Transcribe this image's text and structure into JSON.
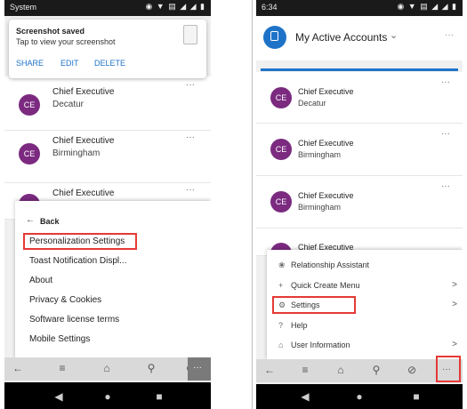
{
  "left": {
    "status": {
      "app": "System",
      "icons": "◉ ▼ ▤ ◢ ◢ ▮"
    },
    "notification": {
      "title": "Screenshot saved",
      "subtitle": "Tap to view your screenshot",
      "actions": [
        "SHARE",
        "EDIT",
        "DELETE"
      ]
    },
    "cards": [
      {
        "initials": "CE",
        "name": "Chief Executive",
        "sub": "Decatur"
      },
      {
        "initials": "CE",
        "name": "Chief Executive",
        "sub": "Birmingham"
      },
      {
        "initials": "CE",
        "name": "Chief Executive",
        "sub": ""
      }
    ],
    "menu": {
      "back": "Back",
      "items": [
        "Personalization Settings",
        "Toast Notification Displ...",
        "About",
        "Privacy & Cookies",
        "Software license terms",
        "Mobile Settings"
      ]
    },
    "more_glyph": "···"
  },
  "right": {
    "status": {
      "time": "6:34",
      "icons": "◉ ▼ ▤ ◢ ◢ ▮"
    },
    "header": {
      "title": "My Active Accounts"
    },
    "cards": [
      {
        "initials": "CE",
        "name": "Chief Executive",
        "sub": "Decatur"
      },
      {
        "initials": "CE",
        "name": "Chief Executive",
        "sub": "Birmingham"
      },
      {
        "initials": "CE",
        "name": "Chief Executive",
        "sub": "Birmingham"
      },
      {
        "initials": "CE",
        "name": "Chief Executive",
        "sub": ""
      }
    ],
    "menu": [
      {
        "icon": "❀",
        "label": "Relationship Assistant",
        "chevron": ""
      },
      {
        "icon": "+",
        "label": "Quick Create Menu",
        "chevron": ">"
      },
      {
        "icon": "⚙",
        "label": "Settings",
        "chevron": ">"
      },
      {
        "icon": "?",
        "label": "Help",
        "chevron": ""
      },
      {
        "icon": "⌂",
        "label": "User Information",
        "chevron": ">"
      }
    ],
    "more_glyph": "···"
  },
  "colors": {
    "avatar": "#7b2a80",
    "accent": "#1e73c8",
    "highlight": "#e53935"
  }
}
